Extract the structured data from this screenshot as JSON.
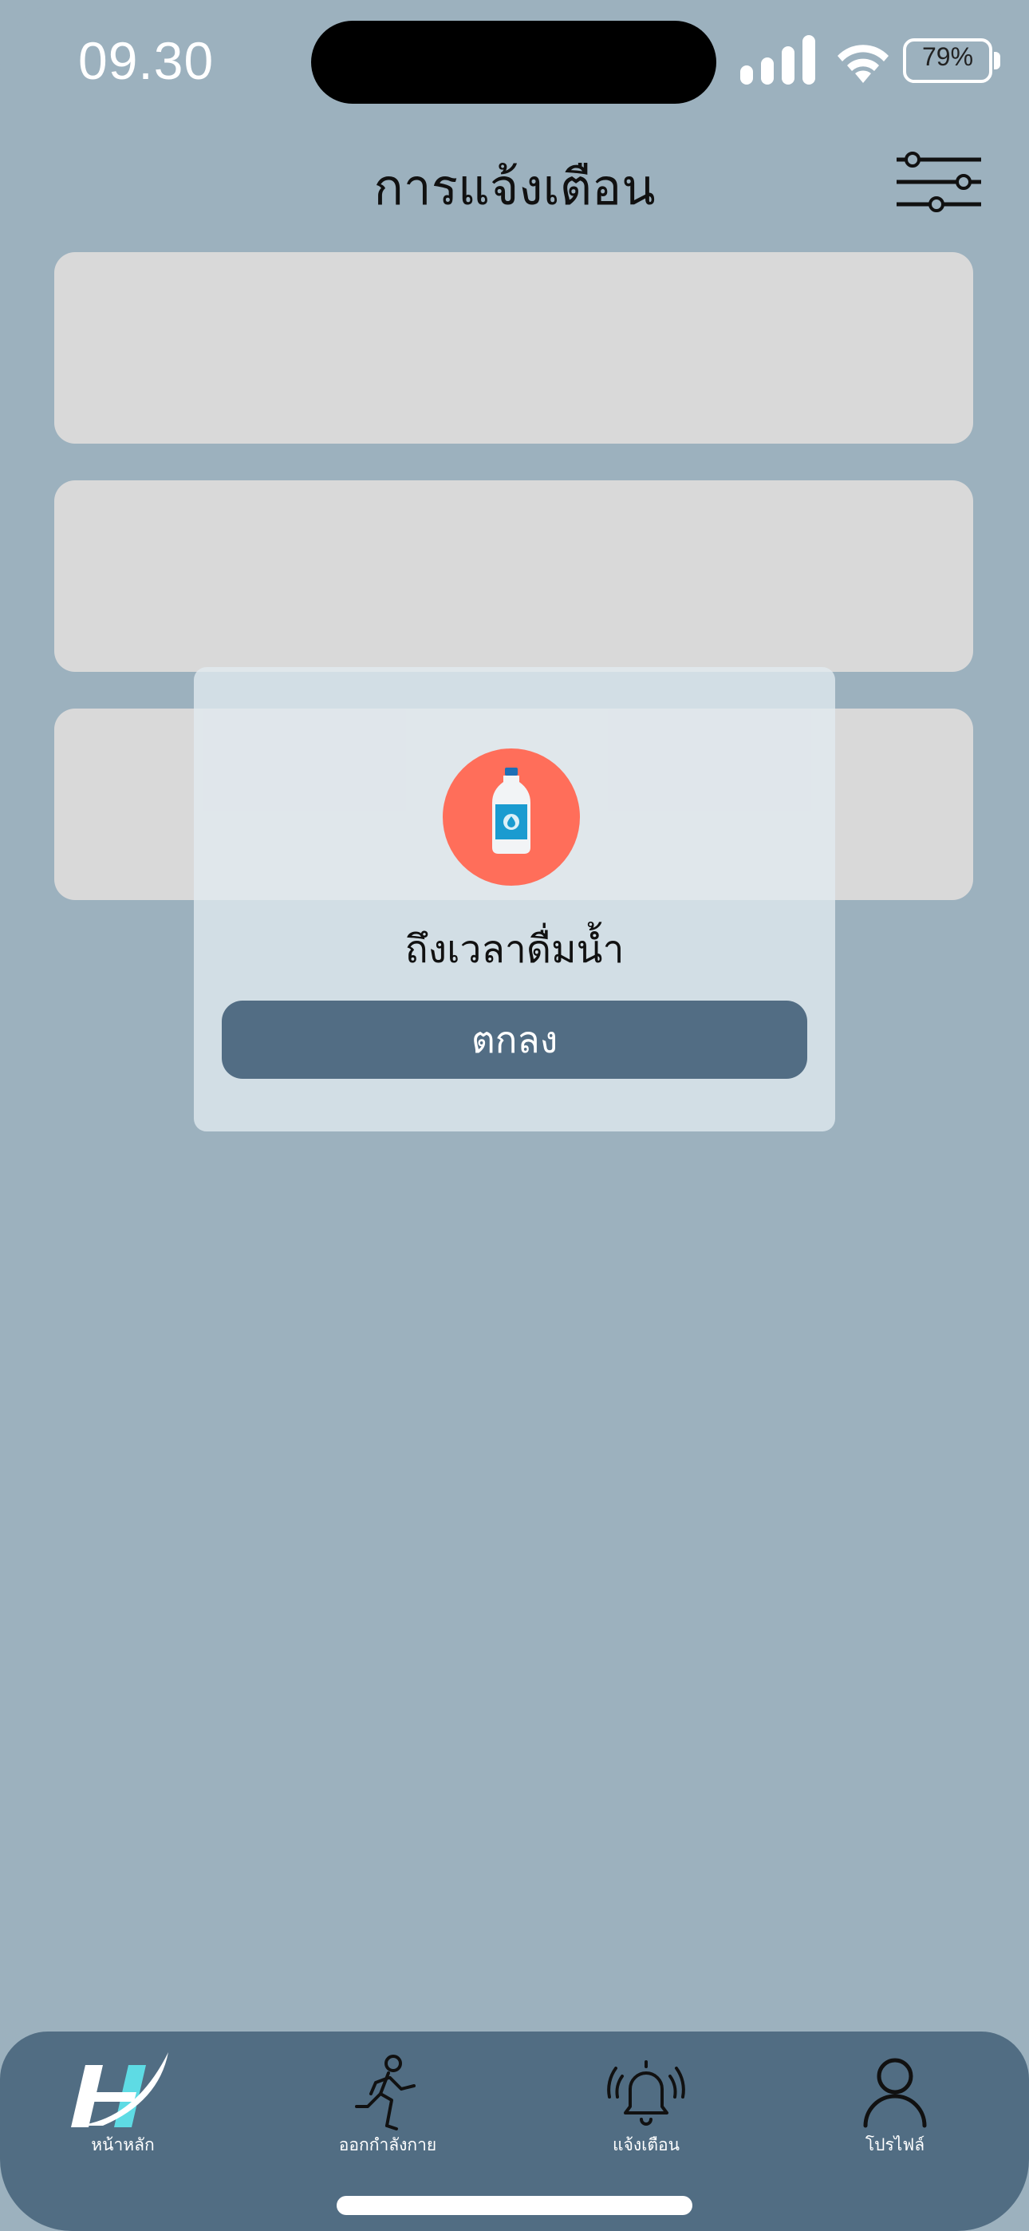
{
  "status_bar": {
    "time": "09.30",
    "battery_percent": "79%",
    "battery_level": 0.79
  },
  "header": {
    "title": "การแจ้งเตือน"
  },
  "notification_cards": [
    {
      "content": ""
    },
    {
      "content": ""
    },
    {
      "content": ""
    }
  ],
  "modal": {
    "icon": "water-bottle-icon",
    "icon_bg": "#FF6E5A",
    "message": "ถึงเวลาดื่มน้ำ",
    "ok_label": "ตกลง"
  },
  "bottom_nav": {
    "items": [
      {
        "label": "หน้าหลัก",
        "icon": "home-logo-icon"
      },
      {
        "label": "ออกกำลังกาย",
        "icon": "runner-icon"
      },
      {
        "label": "แจ้งเตือน",
        "icon": "bell-ringing-icon"
      },
      {
        "label": "โปรไฟล์",
        "icon": "person-icon"
      }
    ]
  },
  "colors": {
    "background": "#9CB1BE",
    "card": "#D9D9D9",
    "accent": "#526D84"
  }
}
